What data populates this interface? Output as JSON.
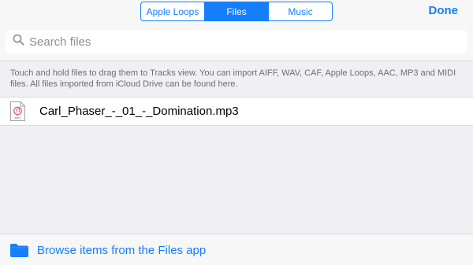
{
  "header": {
    "tabs": [
      {
        "label": "Apple Loops",
        "active": false
      },
      {
        "label": "Files",
        "active": true
      },
      {
        "label": "Music",
        "active": false
      }
    ],
    "done_label": "Done"
  },
  "search": {
    "placeholder": "Search files"
  },
  "info": {
    "text": "Touch and hold files to drag them to Tracks view. You can import AIFF, WAV, CAF, Apple Loops, AAC, MP3 and MIDI files. All files imported from iCloud Drive can be found here."
  },
  "files": [
    {
      "name": "Carl_Phaser_-_01_-_Domination.mp3",
      "icon": "mp3-file-icon",
      "badge": "MP3"
    }
  ],
  "footer": {
    "browse_label": "Browse items from the Files app",
    "icon": "folder-icon"
  },
  "colors": {
    "accent": "#157efb",
    "background": "#efeff4"
  }
}
